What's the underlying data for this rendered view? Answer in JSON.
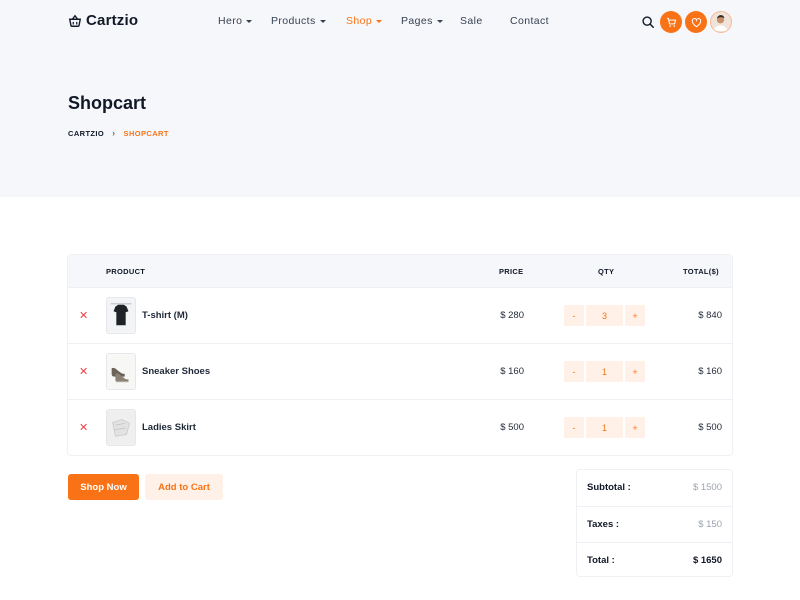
{
  "brand": {
    "name": "Cartzio",
    "accent": "#f97316"
  },
  "nav": {
    "items": [
      {
        "label": "Hero",
        "has_caret": true
      },
      {
        "label": "Products",
        "has_caret": true
      },
      {
        "label": "Shop",
        "has_caret": true,
        "active": true
      },
      {
        "label": "Pages",
        "has_caret": true
      },
      {
        "label": "Sale",
        "has_caret": false
      },
      {
        "label": "Contact",
        "has_caret": false
      }
    ],
    "icons": [
      "search-icon",
      "cart-icon",
      "heart-icon",
      "avatar"
    ]
  },
  "page": {
    "title": "Shopcart",
    "breadcrumb": {
      "home": "CARTZIO",
      "separator": "›",
      "current": "SHOPCART"
    }
  },
  "cart": {
    "headers": {
      "product": "PRODUCT",
      "price": "PRICE",
      "qty": "QTY",
      "total": "TOTAL($)"
    },
    "remove_symbol": "✕",
    "minus": "-",
    "plus": "+",
    "rows": [
      {
        "name": "T-shirt (M)",
        "price": "$ 280",
        "qty": "3",
        "total": "$ 840",
        "thumb": "tshirt"
      },
      {
        "name": "Sneaker Shoes",
        "price": "$ 160",
        "qty": "1",
        "total": "$ 160",
        "thumb": "sneaker"
      },
      {
        "name": "Ladies Skirt",
        "price": "$ 500",
        "qty": "1",
        "total": "$ 500",
        "thumb": "skirt"
      }
    ]
  },
  "actions": {
    "shop_now": "Shop Now",
    "add_to_cart": "Add to Cart"
  },
  "summary": {
    "subtotal_label": "Subtotal :",
    "subtotal": "$ 1500",
    "taxes_label": "Taxes :",
    "taxes": "$ 150",
    "total_label": "Total :",
    "total": "$ 1650"
  }
}
